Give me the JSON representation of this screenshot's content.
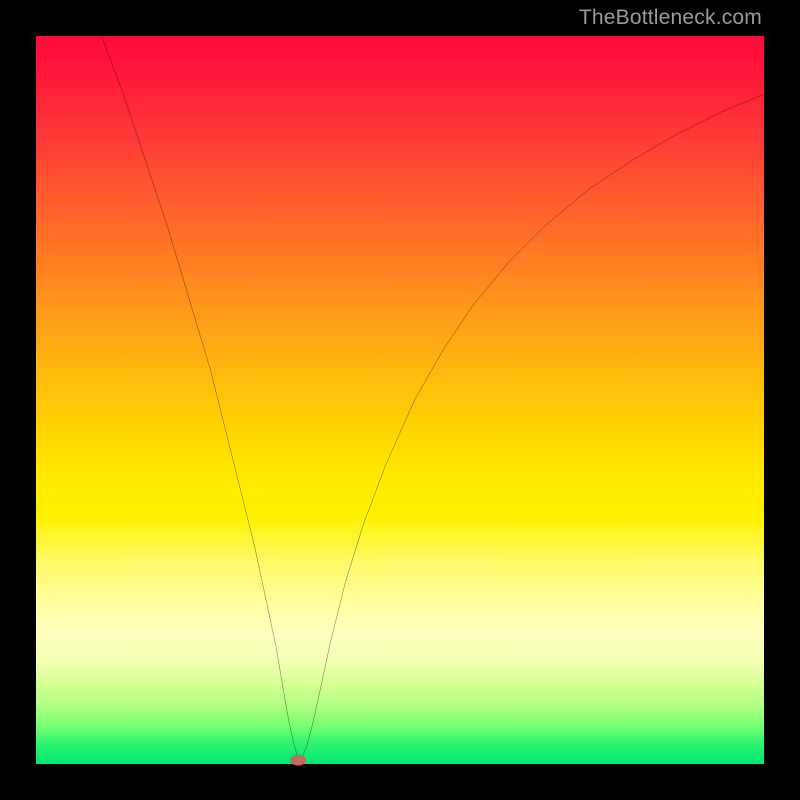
{
  "watermark": "TheBottleneck.com",
  "chart_data": {
    "type": "line",
    "title": "",
    "xlabel": "",
    "ylabel": "",
    "xlim": [
      0,
      100
    ],
    "ylim": [
      0,
      100
    ],
    "grid": false,
    "legend": false,
    "series": [
      {
        "name": "bottleneck-curve",
        "x": [
          9,
          12,
          15,
          18,
          21,
          24,
          26,
          28,
          30,
          31.5,
          33,
          34,
          34.8,
          35.5,
          36,
          36.5,
          37.2,
          38,
          39,
          40.5,
          42.5,
          45,
          48,
          52,
          56,
          60,
          65,
          70,
          76,
          82,
          88,
          94,
          100
        ],
        "y": [
          100,
          92,
          83,
          74,
          64,
          54,
          46,
          38,
          30,
          23,
          16,
          10,
          5.5,
          2.5,
          0.8,
          0.8,
          2.5,
          5.5,
          10,
          17,
          25,
          33,
          41,
          50,
          57,
          63,
          69,
          74,
          79,
          83,
          86.5,
          89.5,
          92
        ]
      }
    ],
    "marker": {
      "x": 36.0,
      "y": 0.6,
      "name": "optimal-point"
    },
    "background": "heatmap-gradient-red-to-green"
  }
}
